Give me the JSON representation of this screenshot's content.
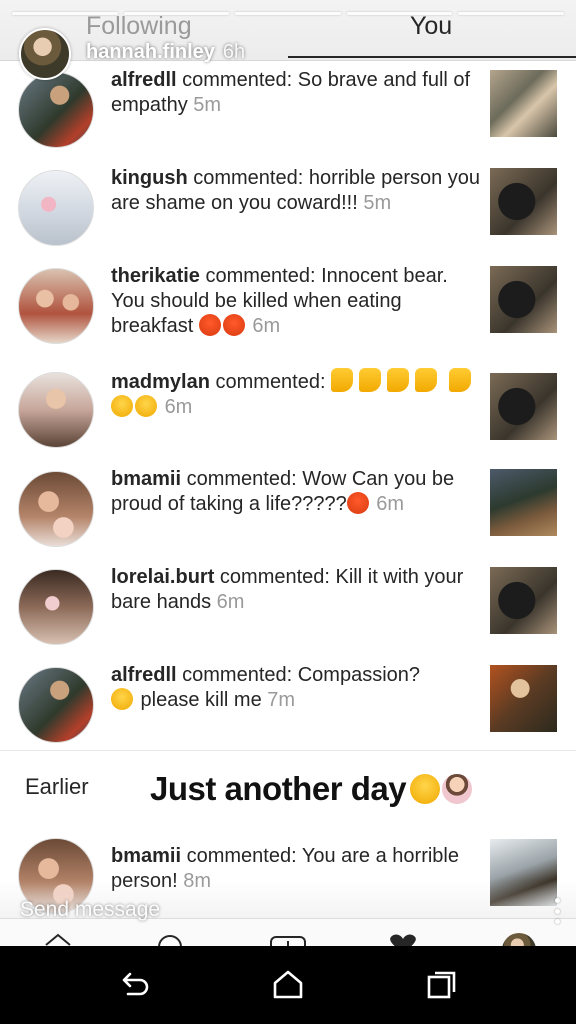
{
  "header": {
    "tab_following": "Following",
    "tab_you": "You",
    "story_user": "hannah.finley",
    "story_time": "6h"
  },
  "activity": [
    {
      "username": "alfredll",
      "text": " commented: So brave and full of empathy",
      "time": "5m"
    },
    {
      "username": "kingush",
      "text": " commented: horrible person you are shame on you coward!!!",
      "time": "5m"
    },
    {
      "username": "therikatie",
      "text": " commented: Innocent bear. You should be killed when eating breakfast",
      "time": "6m"
    },
    {
      "username": "madmylan",
      "text": " commented: ",
      "time": "6m"
    },
    {
      "username": "bmamii",
      "text": " commented: Wow Can you be proud of taking a life?????",
      "time": "6m"
    },
    {
      "username": "lorelai.burt",
      "text": " commented: Kill it with your bare hands",
      "time": "6m"
    },
    {
      "username": "alfredll",
      "text": " commented: Compassion?",
      "text2": " please kill me",
      "time": "7m"
    }
  ],
  "earlier": {
    "heading": "Earlier",
    "caption": "Just another day",
    "items": [
      {
        "username": "bmamii",
        "text": " commented: You are a horrible person!",
        "time": "8m"
      }
    ]
  },
  "story": {
    "send_placeholder": "Send message"
  },
  "icons": [
    "home-icon",
    "search-icon",
    "add-post-icon",
    "heart-icon",
    "profile-icon",
    "back-icon",
    "home-nav-icon",
    "recents-icon"
  ],
  "colors": {
    "text": "#262626",
    "time": "#9a9a9a",
    "angry_emoji": "#e8441a",
    "thumb_emoji": "#f5b800"
  }
}
